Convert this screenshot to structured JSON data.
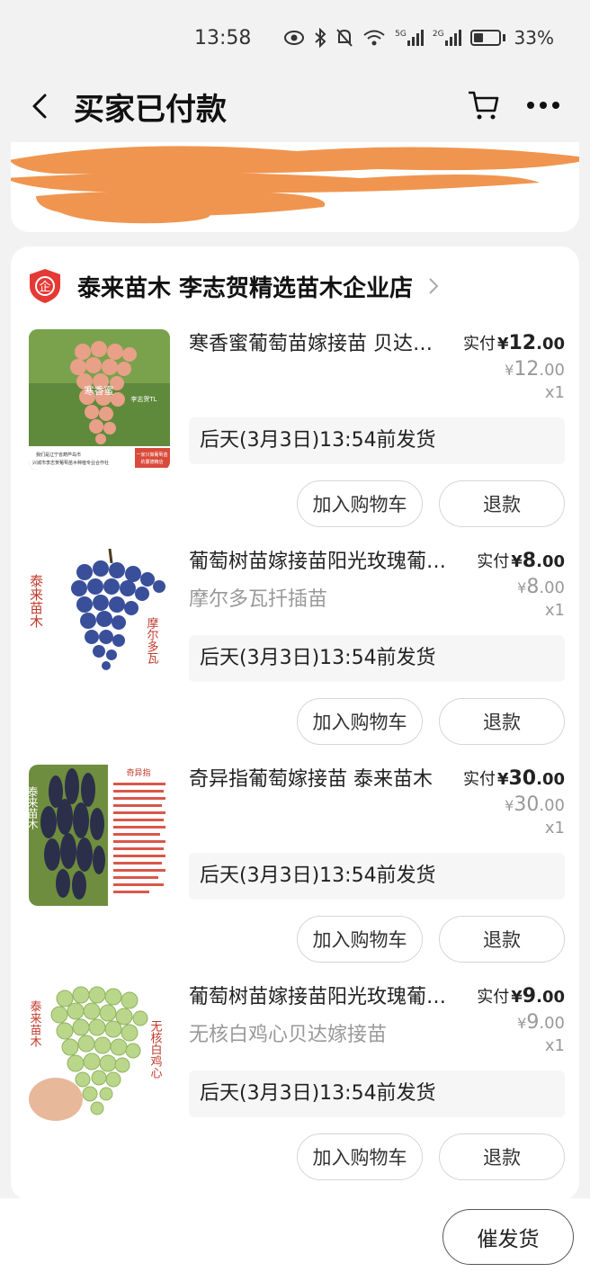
{
  "status_bar": {
    "time": "13:58",
    "network_5g": "5G",
    "network_2g": "2G",
    "battery": "33%"
  },
  "nav": {
    "title": "买家已付款"
  },
  "shop": {
    "name": "泰来苗木 李志贺精选苗木企业店",
    "badge_text": "企"
  },
  "items": [
    {
      "name": "寒香蜜葡萄苗嫁接苗 贝达嫁接苗",
      "sku": "",
      "paid_label": "实付",
      "paid_yen": "¥",
      "paid_int": "12",
      "paid_dec": ".00",
      "orig_yen": "¥",
      "orig_int": "12",
      "orig_dec": ".00",
      "qty": "x1",
      "ship_text": "后天(3月3日)13:54前发货",
      "cart_btn": "加入购物车",
      "refund_btn": "退款",
      "thumb_labels": [
        "寒香蜜",
        "李志贺TL",
        "我们是辽宁省葫芦岛市",
        "兴城市李志贺葡萄苗木种植专业合作社",
        "一家只做葡萄苗",
        "的厦德精店"
      ]
    },
    {
      "name": "葡萄树苗嫁接苗阳光玫瑰葡萄苗",
      "sku": "摩尔多瓦扦插苗",
      "paid_label": "实付",
      "paid_yen": "¥",
      "paid_int": "8",
      "paid_dec": ".00",
      "orig_yen": "¥",
      "orig_int": "8",
      "orig_dec": ".00",
      "qty": "x1",
      "ship_text": "后天(3月3日)13:54前发货",
      "cart_btn": "加入购物车",
      "refund_btn": "退款",
      "thumb_labels": [
        "泰来苗木",
        "摩尔多瓦"
      ]
    },
    {
      "name": "奇异指葡萄嫁接苗 泰来苗木",
      "sku": "",
      "paid_label": "实付",
      "paid_yen": "¥",
      "paid_int": "30",
      "paid_dec": ".00",
      "orig_yen": "¥",
      "orig_int": "30",
      "orig_dec": ".00",
      "qty": "x1",
      "ship_text": "后天(3月3日)13:54前发货",
      "cart_btn": "加入购物车",
      "refund_btn": "退款",
      "thumb_labels": [
        "泰来苗木",
        "奇异指"
      ]
    },
    {
      "name": "葡萄树苗嫁接苗阳光玫瑰葡萄苗",
      "sku": "无核白鸡心贝达嫁接苗",
      "paid_label": "实付",
      "paid_yen": "¥",
      "paid_int": "9",
      "paid_dec": ".00",
      "orig_yen": "¥",
      "orig_int": "9",
      "orig_dec": ".00",
      "qty": "x1",
      "ship_text": "后天(3月3日)13:54前发货",
      "cart_btn": "加入购物车",
      "refund_btn": "退款",
      "thumb_labels": [
        "泰来苗木",
        "无核白鸡心"
      ]
    }
  ],
  "bottom": {
    "urge_btn": "催发货"
  },
  "colors": {
    "redaction": "#f0954f",
    "shop_badge": "#e53935",
    "text_gray": "#999999"
  },
  "icons": [
    "back-arrow-icon",
    "cart-icon",
    "more-icon",
    "eye-icon",
    "bluetooth-icon",
    "mute-icon",
    "wifi-icon",
    "signal-icon",
    "battery-icon",
    "shop-badge-icon",
    "chevron-right-icon"
  ]
}
